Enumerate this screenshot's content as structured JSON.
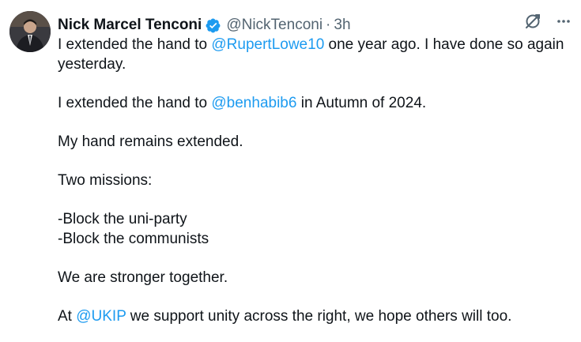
{
  "author": {
    "name": "Nick Marcel Tenconi",
    "handle": "@NickTenconi",
    "separator": "·",
    "time": "3h"
  },
  "icons": {
    "verified": "verified-badge-icon",
    "grok": "grok-icon",
    "more": "more-options-icon"
  },
  "colors": {
    "accent": "#1d9bf0",
    "text": "#0f1419",
    "muted": "#536471"
  },
  "post": {
    "p1": {
      "a": "I extended the hand to ",
      "mention": "@RupertLowe10",
      "b": " one year ago. I have done so again yesterday."
    },
    "p2": {
      "a": "I extended the hand to ",
      "mention": "@benhabib6",
      "b": " in Autumn of 2024."
    },
    "p3": "My hand remains extended.",
    "p4": "Two missions:",
    "p5": {
      "line1": "-Block the uni-party",
      "line2": "-Block the communists"
    },
    "p6": "We are stronger together.",
    "p7": {
      "a": "At ",
      "mention": "@UKIP",
      "b": " we support unity across the right, we hope others will too."
    }
  }
}
